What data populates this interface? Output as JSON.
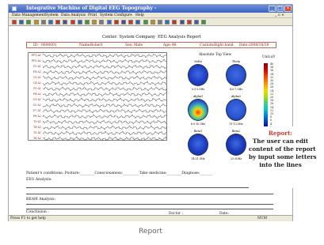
{
  "window": {
    "title": "Integrative Machine of Digital EEG Topography -",
    "buttons": [
      "_",
      "□",
      "×"
    ],
    "inner_buttons": [
      "_",
      "□",
      "×"
    ]
  },
  "menu": [
    "Data Management",
    "System",
    "Data Analysis",
    "Print",
    "System Configure",
    "Help"
  ],
  "toolbar": {
    "icons": [
      "stop-icon",
      "play-icon",
      "next-icon",
      "list-icon",
      "montage-icon",
      "filter-icon",
      "wave-icon",
      "zoom-icon",
      "add-icon",
      "open-icon",
      "save-icon",
      "cut-icon",
      "erase-icon",
      "close-icon",
      "record-icon",
      "record2-icon",
      "mark-icon",
      "text-icon",
      "pen-icon",
      "scan-icon",
      "grid-icon",
      "bar-icon",
      "topo-icon",
      "map-icon",
      "print-icon",
      "report-icon",
      "help-icon"
    ]
  },
  "report": {
    "company": "Center: System Company",
    "title": "EEG Analysis Report",
    "id_label": "ID:",
    "id_value": "0000001",
    "name_label": "Name:",
    "name_value": "Robert",
    "sex_label": "Sex:",
    "sex_value": "Male",
    "age_label": "Age:",
    "age_value": "48",
    "custom_label": "Custom:",
    "custom_value": "Right hand",
    "date_label": "Date:",
    "date_value": "2008/10/28",
    "topo_title": "Absolute Top View",
    "unit_label": "Unit:uV",
    "channels": [
      "FP1-A1",
      "FP2-A2",
      "F3-A1",
      "F4-A2",
      "C3-A1",
      "C4-A2",
      "P3-A1",
      "P4-A2",
      "O1-A1",
      "O2-A2",
      "F7-A1",
      "F8-A2",
      "T3-A1",
      "T4-A2",
      "T5-A1",
      "T6-A2"
    ],
    "maps": [
      {
        "band": "Delta",
        "range": "0.5-3.5Hz",
        "color": "#1e40c8"
      },
      {
        "band": "Theta",
        "range": "4.0-7.5Hz",
        "color": "#2850d0"
      },
      {
        "band": "Alpha1",
        "range": "8.0-10.5Hz",
        "color": "#e02020"
      },
      {
        "band": "Alpha2",
        "range": "11-13.5Hz",
        "color": "#2a56d4"
      },
      {
        "band": "Beta1",
        "range": "14-21.5Hz",
        "color": "#1c3cc4"
      },
      {
        "band": "Beta2",
        "range": "22-30Hz",
        "color": "#1a36bc"
      }
    ],
    "scale_labels": [
      "40",
      "38",
      "36",
      "34",
      "32",
      "30",
      "28",
      "26",
      "24",
      "22",
      "20",
      "18",
      "16",
      "14",
      "12",
      "10",
      "8",
      "6",
      "4",
      "2",
      "0"
    ],
    "conditions_text": "Patient's conditions: Posture:________Consciousness:_________Take medicine:________Diagnose:_______",
    "eeg_analysis": "EEG Analysis:",
    "beam_analysis": "BEAM Analysis:",
    "conclusion": "Conclusion :",
    "doctor": "Doctor :",
    "date2": "Date:"
  },
  "callout": {
    "title": "Report:",
    "lines": [
      "The user can edit",
      "content of the report",
      "by input some letters",
      "into the lines"
    ]
  },
  "status": {
    "left": "Press F1 to get help",
    "right": "NUM"
  },
  "caption": "Report"
}
